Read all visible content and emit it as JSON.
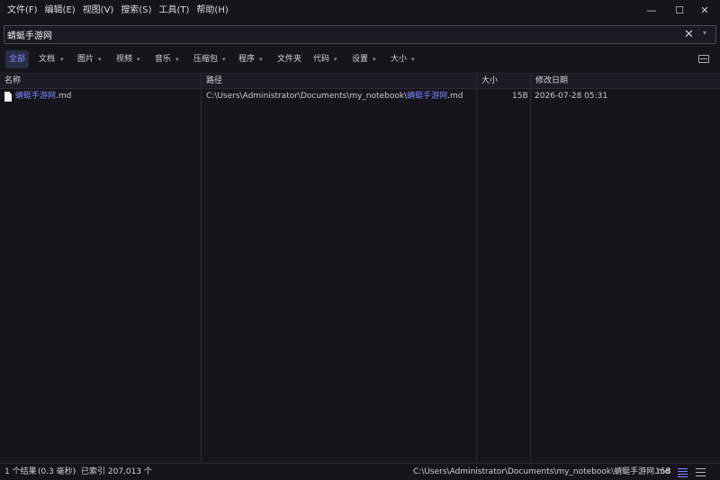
{
  "menu": [
    "文件(F)",
    "编辑(E)",
    "视图(V)",
    "搜索(S)",
    "工具(T)",
    "帮助(H)"
  ],
  "window": {
    "minimize": "—",
    "maximize": "☐",
    "close": "✕"
  },
  "search": {
    "value": "蜻蜓手游网",
    "clear": "✕",
    "dropdown": "▾"
  },
  "filters": [
    {
      "label": "全部",
      "active": true
    },
    {
      "label": "文档"
    },
    {
      "label": "图片"
    },
    {
      "label": "视频"
    },
    {
      "label": "音乐"
    },
    {
      "label": "压缩包"
    },
    {
      "label": "程序"
    },
    {
      "label": "文件夹"
    },
    {
      "label": "代码"
    },
    {
      "label": "设置"
    },
    {
      "label": "大小"
    }
  ],
  "chevron": "▾",
  "columns": {
    "name": "名称",
    "path": "路径",
    "size": "大小",
    "modified": "修改日期"
  },
  "rows": [
    {
      "name_highlight": "蜻蜓手游网",
      "name_rest": ".md",
      "path_prefix": "C:\\Users\\Administrator\\Documents\\my_notebook\\",
      "path_highlight": "蜻蜓手游网",
      "path_rest": ".md",
      "size": "15B",
      "modified": "2026-07-28 05:31"
    }
  ],
  "status": {
    "results": "1 个结果",
    "time": "(0.3 毫秒)",
    "separator": "·",
    "indexed": "已索引 207,013 个",
    "selected_path": "C:\\Users\\Administrator\\Documents\\my_notebook\\蜻蜓手游网.md",
    "selected_size": "15B"
  },
  "colors": {
    "accent": "#7e86ff",
    "background": "#16151c"
  },
  "icons": [
    "file-icon",
    "layout-icon",
    "list-view-icon",
    "detail-view-icon"
  ]
}
